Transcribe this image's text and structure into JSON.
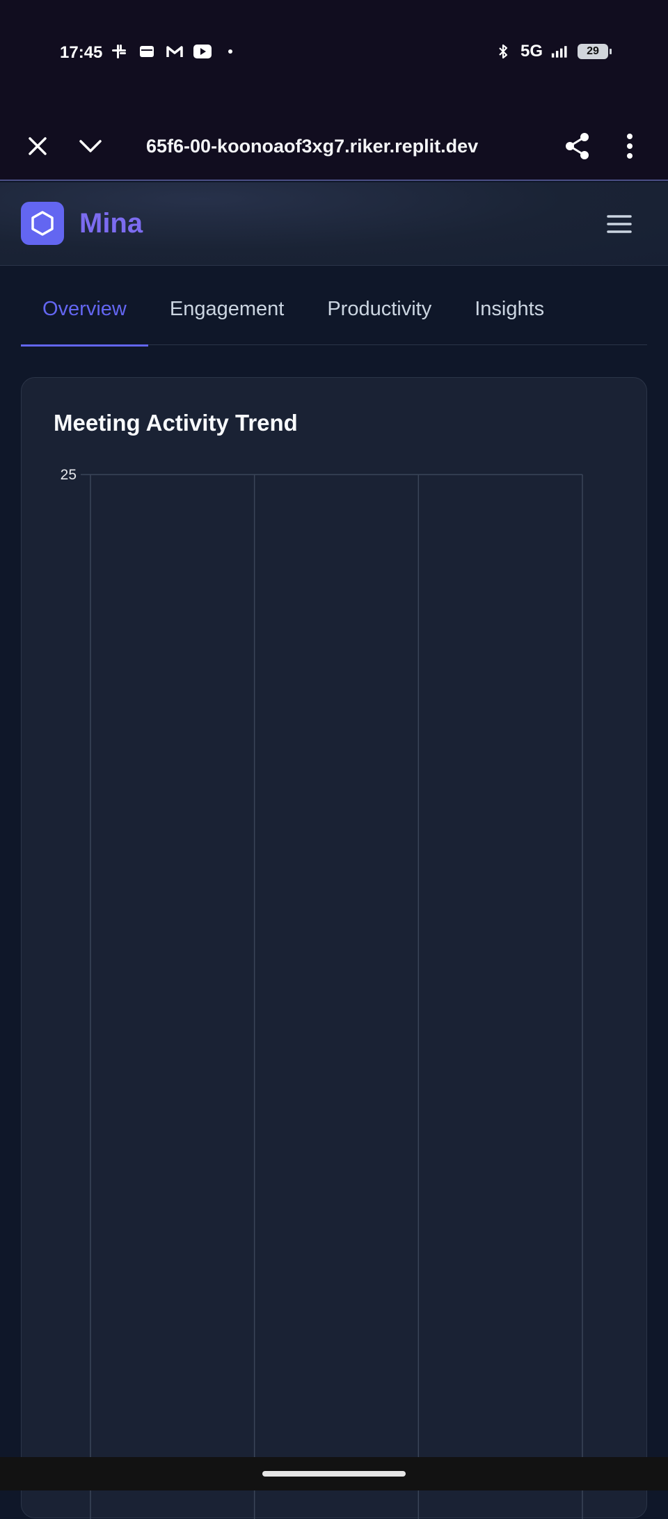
{
  "status_bar": {
    "time": "17:45",
    "notification_icons": [
      "slack-icon",
      "wallet-icon",
      "gmail-icon",
      "youtube-icon",
      "dot-icon"
    ],
    "network": "5G",
    "battery": "29"
  },
  "browser": {
    "url": "65f6-00-koonoaof3xg7.riker.replit.dev"
  },
  "app": {
    "brand": "Mina",
    "tabs": [
      {
        "label": "Overview",
        "active": true
      },
      {
        "label": "Engagement",
        "active": false
      },
      {
        "label": "Productivity",
        "active": false
      },
      {
        "label": "Insights",
        "active": false
      }
    ]
  },
  "card": {
    "title": "Meeting Activity Trend"
  },
  "chart_data": {
    "type": "line",
    "title": "Meeting Activity Trend",
    "ytick_labels": [
      "25"
    ],
    "ylim_max": 25,
    "vertical_gridlines": 4,
    "series": []
  },
  "colors": {
    "accent": "#6366f1",
    "background": "#0f1729",
    "card": "#1a2234"
  }
}
